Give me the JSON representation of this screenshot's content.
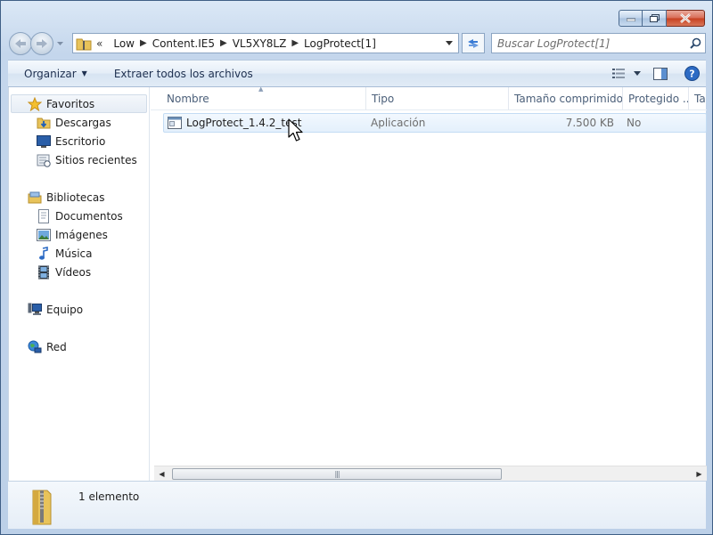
{
  "window": {
    "caption_buttons": [
      "minimize-icon",
      "maximize-icon",
      "close-icon"
    ]
  },
  "address_bar": {
    "overflow": "«",
    "crumbs": [
      "Low",
      "Content.IE5",
      "VL5XY8LZ",
      "LogProtect[1]"
    ]
  },
  "search": {
    "placeholder": "Buscar LogProtect[1]"
  },
  "toolbar": {
    "organize_label": "Organizar",
    "extract_label": "Extraer todos los archivos"
  },
  "nav_pane": {
    "favorites": {
      "label": "Favoritos",
      "items": [
        "Descargas",
        "Escritorio",
        "Sitios recientes"
      ]
    },
    "libraries": {
      "label": "Bibliotecas",
      "items": [
        "Documentos",
        "Imágenes",
        "Música",
        "Vídeos"
      ]
    },
    "computer": {
      "label": "Equipo"
    },
    "network": {
      "label": "Red"
    }
  },
  "columns": [
    "Nombre",
    "Tipo",
    "Tamaño comprimido",
    "Protegido ...",
    "Ta"
  ],
  "files": [
    {
      "name": "LogProtect_1.4.2_test",
      "type": "Aplicación",
      "size": "7.500 KB",
      "protected": "No"
    }
  ],
  "details": {
    "count_text": "1 elemento"
  },
  "colors": {
    "accent": "#3f5f86",
    "selection": "#e4f0fc",
    "close": "#c7401f"
  }
}
